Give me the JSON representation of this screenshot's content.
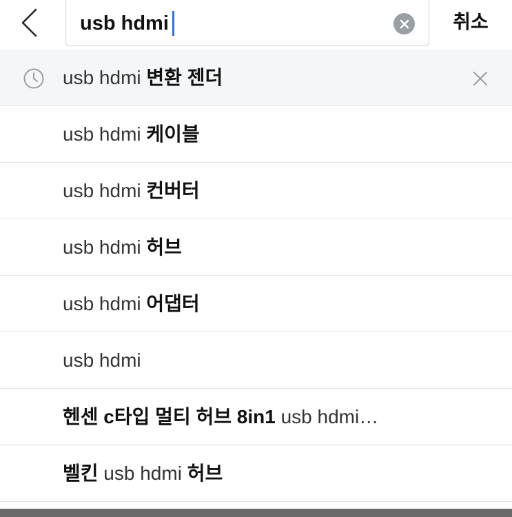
{
  "search": {
    "query": "usb hdmi",
    "cancel_label": "취소"
  },
  "suggestions": [
    {
      "type": "recent",
      "prefix": "usb hdmi ",
      "suffix": "변환 젠더"
    },
    {
      "type": "suggest",
      "prefix": "usb hdmi ",
      "suffix": "케이블"
    },
    {
      "type": "suggest",
      "prefix": "usb hdmi ",
      "suffix": "컨버터"
    },
    {
      "type": "suggest",
      "prefix": "usb hdmi ",
      "suffix": "허브"
    },
    {
      "type": "suggest",
      "prefix": "usb hdmi ",
      "suffix": "어댑터"
    },
    {
      "type": "suggest",
      "prefix": "usb hdmi",
      "suffix": ""
    },
    {
      "type": "product",
      "bold_a": "헨센 c타입 멀티 허브 8in1",
      "light_b": " usb hdmi…"
    },
    {
      "type": "product",
      "bold_a": "벨킨",
      "light_b": " usb hdmi ",
      "bold_c": "허브"
    }
  ],
  "icons": {
    "back": "chevron-left-icon",
    "clear": "clear-circle-icon",
    "recent": "clock-icon",
    "remove": "close-icon"
  },
  "colors": {
    "caret": "#2f6fe8",
    "recent_row_bg": "#f4f6f8",
    "divider": "#e2e4e7"
  }
}
